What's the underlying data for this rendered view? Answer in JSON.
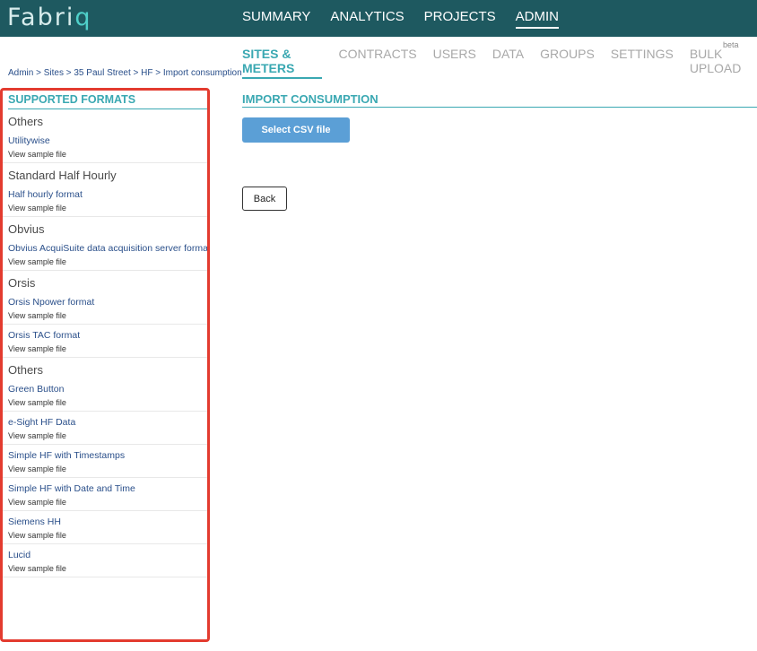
{
  "brand": {
    "name": "Fabriq"
  },
  "topnav": {
    "items": [
      {
        "label": "SUMMARY"
      },
      {
        "label": "ANALYTICS"
      },
      {
        "label": "PROJECTS"
      },
      {
        "label": "ADMIN",
        "active": true
      }
    ]
  },
  "subnav": {
    "items": [
      {
        "label": "SITES & METERS",
        "active": true
      },
      {
        "label": "CONTRACTS"
      },
      {
        "label": "USERS"
      },
      {
        "label": "DATA"
      },
      {
        "label": "GROUPS"
      },
      {
        "label": "SETTINGS"
      },
      {
        "label": "BULK UPLOAD"
      }
    ],
    "beta": "beta"
  },
  "breadcrumb": "Admin > Sites > 35 Paul Street > HF > Import consumption",
  "sidebar": {
    "title": "SUPPORTED FORMATS",
    "sample_label": "View sample file",
    "formats": [
      {
        "group": "Others",
        "name": "Utilitywise"
      },
      {
        "group": "Standard Half Hourly",
        "name": "Half hourly format"
      },
      {
        "group": "Obvius",
        "name": "Obvius AcquiSuite data acquisition server format"
      },
      {
        "group": "Orsis",
        "name": "Orsis Npower format"
      },
      {
        "group": "",
        "name": "Orsis TAC format"
      },
      {
        "group": "Others",
        "name": "Green Button"
      },
      {
        "group": "",
        "name": "e-Sight HF Data"
      },
      {
        "group": "",
        "name": "Simple HF with Timestamps"
      },
      {
        "group": "",
        "name": "Simple HF with Date and Time"
      },
      {
        "group": "",
        "name": "Siemens HH"
      },
      {
        "group": "",
        "name": "Lucid"
      }
    ]
  },
  "main": {
    "title": "IMPORT CONSUMPTION",
    "select_csv_label": "Select CSV file",
    "back_label": "Back"
  },
  "colors": {
    "topbar": "#1e5960",
    "accent": "#3aa8b2",
    "button": "#5b9fd6",
    "highlight_border": "#e33b2f"
  }
}
